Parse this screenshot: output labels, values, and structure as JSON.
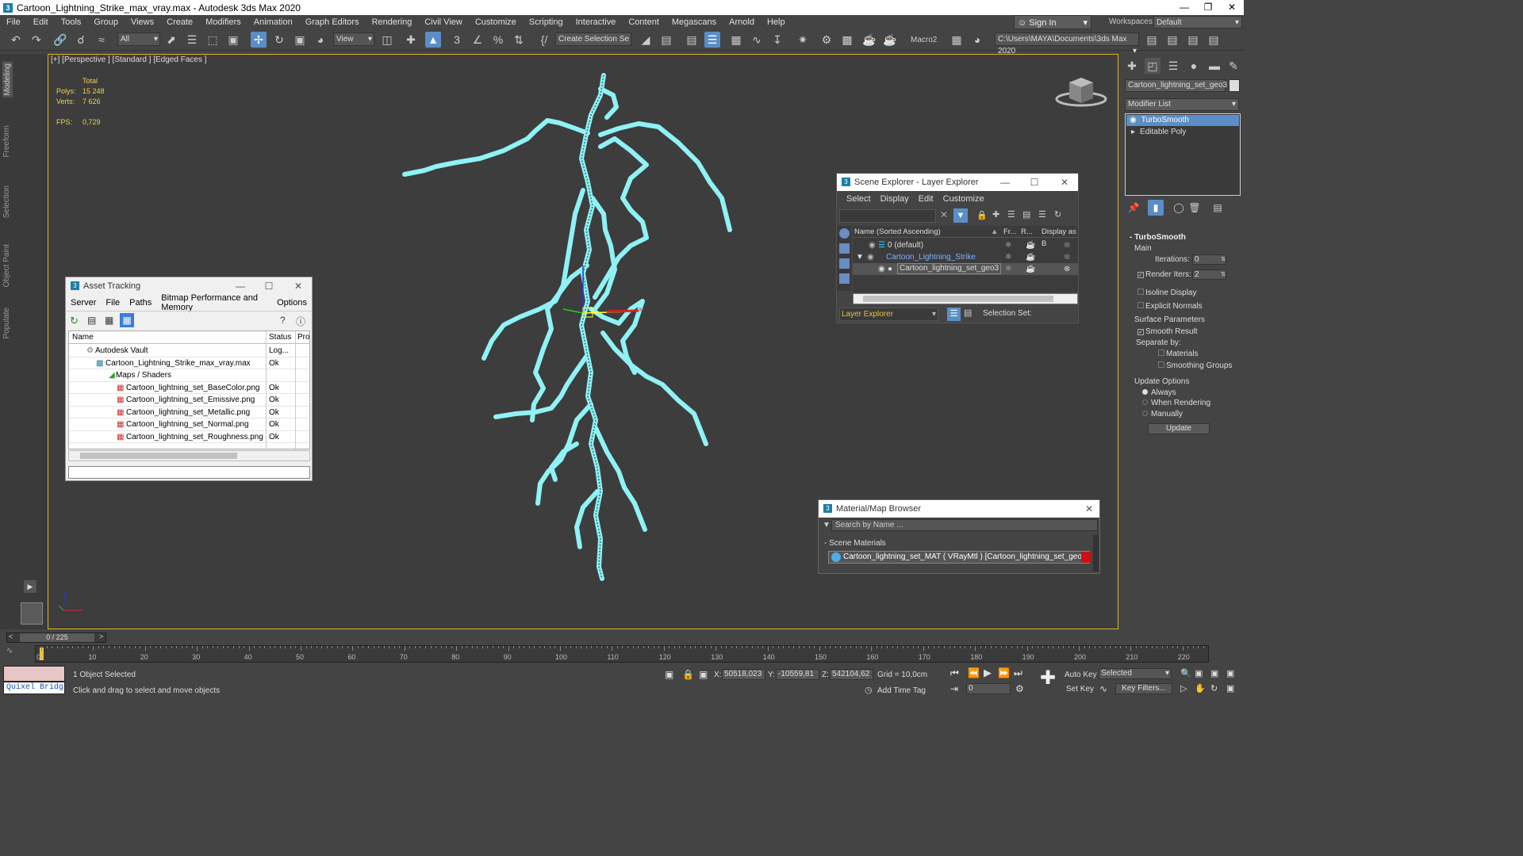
{
  "title": "Cartoon_Lightning_Strike_max_vray.max - Autodesk 3ds Max 2020",
  "menu": [
    "File",
    "Edit",
    "Tools",
    "Group",
    "Views",
    "Create",
    "Modifiers",
    "Animation",
    "Graph Editors",
    "Rendering",
    "Civil View",
    "Customize",
    "Scripting",
    "Interactive",
    "Content",
    "Megascans",
    "Arnold",
    "Help"
  ],
  "signin": "Sign In",
  "workspace": {
    "label": "Workspaces:",
    "value": "Default"
  },
  "toolbar": {
    "filter": "All",
    "refcoord": "View",
    "selset": "Create Selection Se",
    "macro": "Macro2",
    "path": "C:\\Users\\MAYA\\Documents\\3ds Max 2020"
  },
  "left_tabs": [
    "Modeling",
    "Freeform",
    "Selection",
    "Object Paint",
    "Populate"
  ],
  "viewport": {
    "label": "[+] [Perspective ] [Standard ] [Edged Faces ]",
    "stats": {
      "total": "Total",
      "polys_label": "Polys:",
      "polys": "15 248",
      "verts_label": "Verts:",
      "verts": "7 626",
      "fps_label": "FPS:",
      "fps": "0,729"
    },
    "gizmo_x": "x"
  },
  "asset_tracking": {
    "title": "Asset Tracking",
    "menu": [
      "Server",
      "File",
      "Paths",
      "Bitmap Performance and Memory",
      "Options"
    ],
    "columns": [
      "Name",
      "Status",
      "Pro"
    ],
    "rows": [
      {
        "name": "Autodesk Vault",
        "status": "Log..."
      },
      {
        "name": "Cartoon_Lightning_Strike_max_vray.max",
        "status": "Ok"
      },
      {
        "name": "Maps / Shaders",
        "status": ""
      },
      {
        "name": "Cartoon_lightning_set_BaseColor.png",
        "status": "Ok"
      },
      {
        "name": "Cartoon_lightning_set_Emissive.png",
        "status": "Ok"
      },
      {
        "name": "Cartoon_lightning_set_Metallic.png",
        "status": "Ok"
      },
      {
        "name": "Cartoon_lightning_set_Normal.png",
        "status": "Ok"
      },
      {
        "name": "Cartoon_lightning_set_Roughness.png",
        "status": "Ok"
      }
    ]
  },
  "scene_explorer": {
    "title": "Scene Explorer - Layer Explorer",
    "menu": [
      "Select",
      "Display",
      "Edit",
      "Customize"
    ],
    "columns": [
      "Name (Sorted Ascending)",
      "Fr...",
      "R...",
      "Display as B"
    ],
    "rows": [
      {
        "name": "0 (default)"
      },
      {
        "name": "Cartoon_Lightning_Strike"
      },
      {
        "name": "Cartoon_lightning_set_geo3"
      }
    ],
    "layer_explorer": "Layer Explorer",
    "selection_set": "Selection Set:"
  },
  "material_browser": {
    "title": "Material/Map Browser",
    "search_placeholder": "Search by Name ...",
    "group": "- Scene Materials",
    "material": "Cartoon_lightning_set_MAT ( VRayMtl ) [Cartoon_lightning_set_geo3]"
  },
  "command_panel": {
    "object_name": "Cartoon_lightning_set_geo3",
    "modifier_list": "Modifier List",
    "stack": [
      "TurboSmooth",
      "Editable Poly"
    ],
    "rollout": "TurboSmooth",
    "main": "Main",
    "iterations_label": "Iterations:",
    "iterations": "0",
    "render_iters_label": "Render Iters:",
    "render_iters": "2",
    "isoline": "Isoline Display",
    "explicit": "Explicit Normals",
    "surface": "Surface Parameters",
    "smooth": "Smooth Result",
    "separate": "Separate by:",
    "materials": "Materials",
    "smoothing": "Smoothing Groups",
    "update_options": "Update Options",
    "always": "Always",
    "when_rendering": "When Rendering",
    "manually": "Manually",
    "update": "Update"
  },
  "timeline": {
    "frame": "0 / 225",
    "ticks": [
      "0",
      "10",
      "20",
      "30",
      "40",
      "50",
      "60",
      "70",
      "80",
      "90",
      "100",
      "110",
      "120",
      "130",
      "140",
      "150",
      "160",
      "170",
      "180",
      "190",
      "200",
      "210",
      "220"
    ]
  },
  "status": {
    "quixel": "Quixel Bridg",
    "selected": "1 Object Selected",
    "hint": "Click and drag to select and move objects",
    "x_label": "X:",
    "x": "50518,023",
    "y_label": "Y:",
    "y": "-10559,81",
    "z_label": "Z:",
    "z": "542104,62",
    "grid": "Grid = 10,0cm",
    "addtag": "Add Time Tag",
    "autokey": "Auto Key",
    "setkey": "Set Key",
    "selected_drop": "Selected",
    "keyfilters": "Key Filters...",
    "frame_field": "0"
  }
}
